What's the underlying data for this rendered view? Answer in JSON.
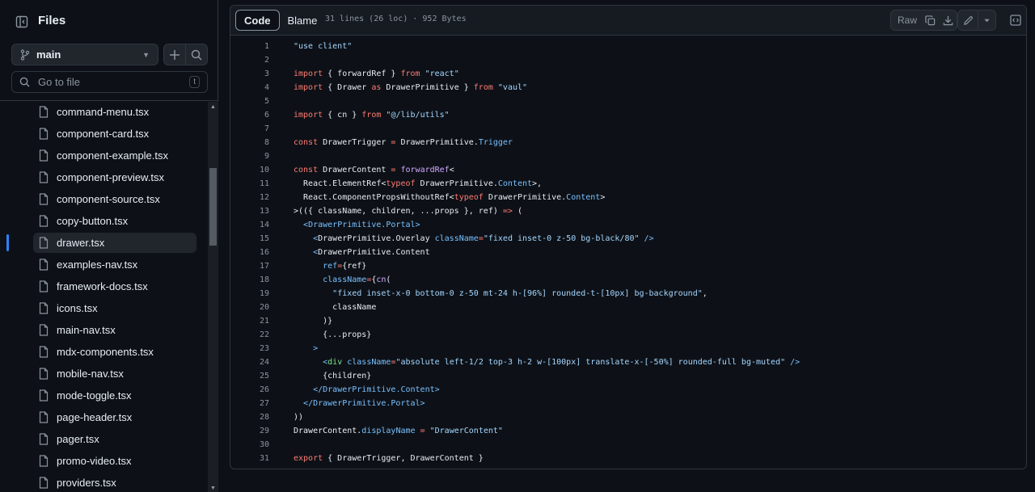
{
  "sidebar": {
    "title": "Files",
    "branch": "main",
    "search_placeholder": "Go to file",
    "search_shortcut": "t",
    "files": [
      {
        "label": "command-menu.tsx",
        "active": false
      },
      {
        "label": "component-card.tsx",
        "active": false
      },
      {
        "label": "component-example.tsx",
        "active": false
      },
      {
        "label": "component-preview.tsx",
        "active": false
      },
      {
        "label": "component-source.tsx",
        "active": false
      },
      {
        "label": "copy-button.tsx",
        "active": false
      },
      {
        "label": "drawer.tsx",
        "active": true
      },
      {
        "label": "examples-nav.tsx",
        "active": false
      },
      {
        "label": "framework-docs.tsx",
        "active": false
      },
      {
        "label": "icons.tsx",
        "active": false
      },
      {
        "label": "main-nav.tsx",
        "active": false
      },
      {
        "label": "mdx-components.tsx",
        "active": false
      },
      {
        "label": "mobile-nav.tsx",
        "active": false
      },
      {
        "label": "mode-toggle.tsx",
        "active": false
      },
      {
        "label": "page-header.tsx",
        "active": false
      },
      {
        "label": "pager.tsx",
        "active": false
      },
      {
        "label": "promo-video.tsx",
        "active": false
      },
      {
        "label": "providers.tsx",
        "active": false
      }
    ]
  },
  "toolbar": {
    "code_tab": "Code",
    "blame_tab": "Blame",
    "file_info": "31 lines (26 loc) · 952 Bytes",
    "raw_label": "Raw"
  },
  "code": {
    "lines": [
      [
        [
          "s",
          "\"use client\""
        ]
      ],
      [],
      [
        [
          "k",
          "import"
        ],
        [
          "",
          " { forwardRef } "
        ],
        [
          "k",
          "from"
        ],
        [
          "",
          " "
        ],
        [
          "s",
          "\"react\""
        ]
      ],
      [
        [
          "k",
          "import"
        ],
        [
          "",
          " { Drawer "
        ],
        [
          "k",
          "as"
        ],
        [
          "",
          " DrawerPrimitive } "
        ],
        [
          "k",
          "from"
        ],
        [
          "",
          " "
        ],
        [
          "s",
          "\"vaul\""
        ]
      ],
      [],
      [
        [
          "k",
          "import"
        ],
        [
          "",
          " { cn } "
        ],
        [
          "k",
          "from"
        ],
        [
          "",
          " "
        ],
        [
          "s",
          "\"@/lib/utils\""
        ]
      ],
      [],
      [
        [
          "k",
          "const"
        ],
        [
          "",
          " DrawerTrigger "
        ],
        [
          "k",
          "="
        ],
        [
          "",
          " DrawerPrimitive."
        ],
        [
          "p",
          "Trigger"
        ]
      ],
      [],
      [
        [
          "k",
          "const"
        ],
        [
          "",
          " DrawerContent "
        ],
        [
          "k",
          "="
        ],
        [
          "",
          " "
        ],
        [
          "f",
          "forwardRef"
        ],
        [
          "",
          "<"
        ]
      ],
      [
        [
          "",
          "  React.ElementRef<"
        ],
        [
          "k",
          "typeof"
        ],
        [
          "",
          " DrawerPrimitive."
        ],
        [
          "p",
          "Content"
        ],
        [
          "",
          ">,"
        ]
      ],
      [
        [
          "",
          "  React.ComponentPropsWithoutRef<"
        ],
        [
          "k",
          "typeof"
        ],
        [
          "",
          " DrawerPrimitive."
        ],
        [
          "p",
          "Content"
        ],
        [
          "",
          ">"
        ]
      ],
      [
        [
          "",
          ">(({ className, children, ...props }, ref) "
        ],
        [
          "k",
          "=>"
        ],
        [
          "",
          " ("
        ]
      ],
      [
        [
          "",
          "  "
        ],
        [
          "p",
          "<DrawerPrimitive.Portal>"
        ]
      ],
      [
        [
          "",
          "    "
        ],
        [
          "p",
          "<"
        ],
        [
          "",
          "DrawerPrimitive.Overlay "
        ],
        [
          "p",
          "className"
        ],
        [
          "k",
          "="
        ],
        [
          "s",
          "\"fixed inset-0 z-50 bg-black/80\""
        ],
        [
          "",
          " "
        ],
        [
          "p",
          "/>"
        ]
      ],
      [
        [
          "",
          "    "
        ],
        [
          "p",
          "<"
        ],
        [
          "",
          "DrawerPrimitive.Content"
        ]
      ],
      [
        [
          "",
          "      "
        ],
        [
          "p",
          "ref"
        ],
        [
          "k",
          "="
        ],
        [
          "",
          "{ref}"
        ]
      ],
      [
        [
          "",
          "      "
        ],
        [
          "p",
          "className"
        ],
        [
          "k",
          "="
        ],
        [
          "",
          "{"
        ],
        [
          "f",
          "cn"
        ],
        [
          "",
          "("
        ]
      ],
      [
        [
          "",
          "        "
        ],
        [
          "s",
          "\"fixed inset-x-0 bottom-0 z-50 mt-24 h-[96%] rounded-t-[10px] bg-background\""
        ],
        [
          "",
          ","
        ]
      ],
      [
        [
          "",
          "        className"
        ]
      ],
      [
        [
          "",
          "      )}"
        ]
      ],
      [
        [
          "",
          "      {...props}"
        ]
      ],
      [
        [
          "",
          "    "
        ],
        [
          "p",
          ">"
        ]
      ],
      [
        [
          "",
          "      "
        ],
        [
          "p",
          "<"
        ],
        [
          "t",
          "div"
        ],
        [
          "",
          " "
        ],
        [
          "p",
          "className"
        ],
        [
          "k",
          "="
        ],
        [
          "s",
          "\"absolute left-1/2 top-3 h-2 w-[100px] translate-x-[-50%] rounded-full bg-muted\""
        ],
        [
          "",
          " "
        ],
        [
          "p",
          "/>"
        ]
      ],
      [
        [
          "",
          "      {children}"
        ]
      ],
      [
        [
          "",
          "    "
        ],
        [
          "p",
          "</DrawerPrimitive.Content>"
        ]
      ],
      [
        [
          "",
          "  "
        ],
        [
          "p",
          "</DrawerPrimitive.Portal>"
        ]
      ],
      [
        [
          "",
          "))"
        ]
      ],
      [
        [
          "",
          "DrawerContent."
        ],
        [
          "p",
          "displayName"
        ],
        [
          "",
          " "
        ],
        [
          "k",
          "="
        ],
        [
          "",
          " "
        ],
        [
          "s",
          "\"DrawerContent\""
        ]
      ],
      [],
      [
        [
          "k",
          "export"
        ],
        [
          "",
          " { DrawerTrigger, DrawerContent }"
        ]
      ]
    ]
  }
}
